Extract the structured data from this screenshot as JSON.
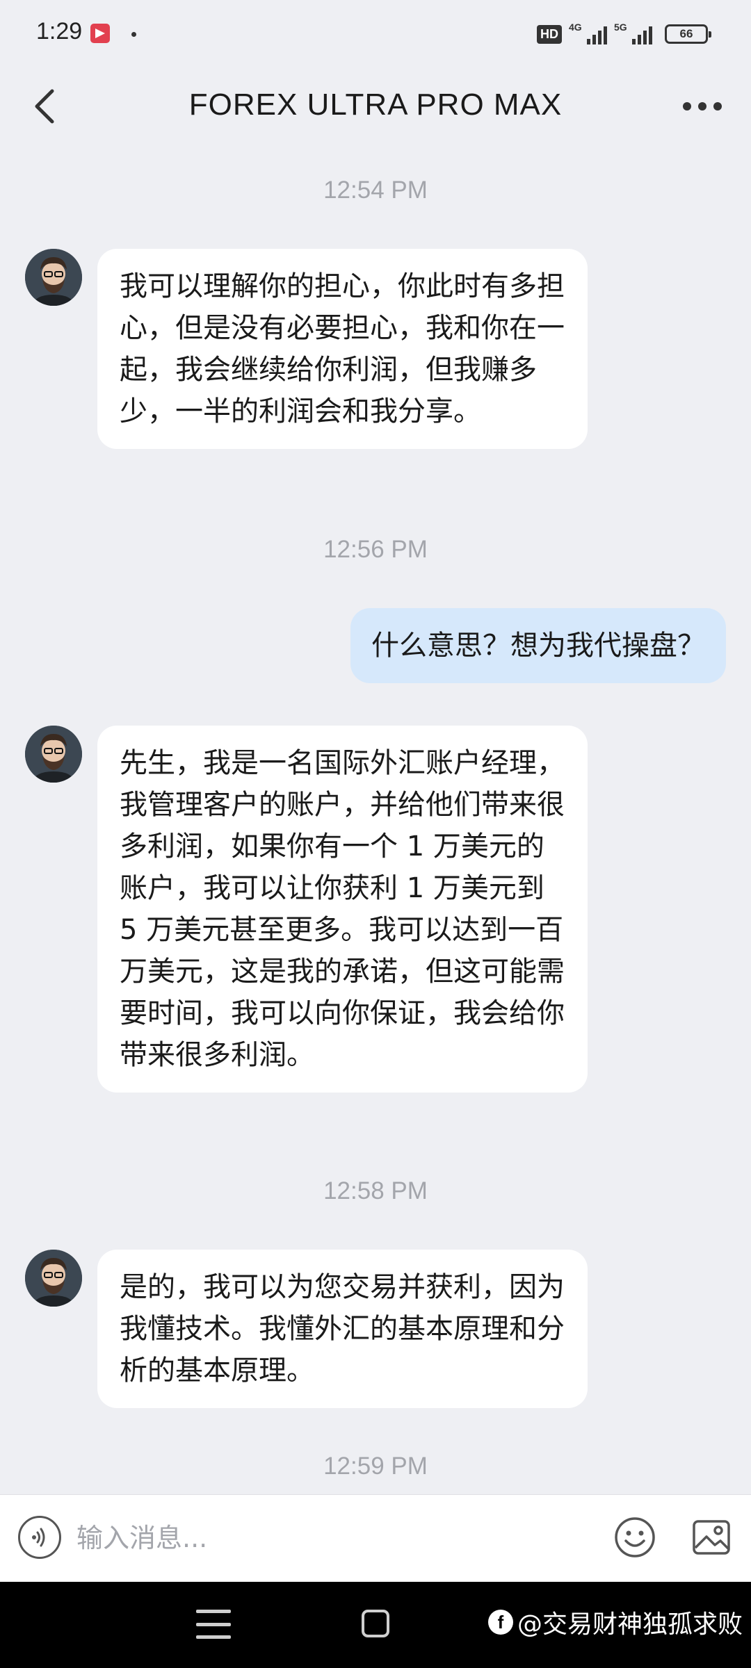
{
  "status_bar": {
    "time": "1:29",
    "hd_badge": "HD",
    "network_1": "4G",
    "network_2": "5G",
    "battery": "66"
  },
  "header": {
    "title": "FOREX ULTRA PRO MAX",
    "back_icon": "chevron-left-icon",
    "more_icon": "more-horizontal-icon"
  },
  "messages": [
    {
      "type": "time",
      "text": "12:54 PM"
    },
    {
      "type": "incoming",
      "text": "我可以理解你的担心，你此时有多担心，但是没有必要担心，我和你在一起，我会继续给你利润，但我赚多少，一半的利润会和我分享。"
    },
    {
      "type": "time",
      "text": "12:56 PM"
    },
    {
      "type": "outgoing",
      "text": "什么意思？想为我代操盘？"
    },
    {
      "type": "incoming",
      "text": "先生，我是一名国际外汇账户经理，我管理客户的账户，并给他们带来很多利润，如果你有一个 1 万美元的账户，我可以让你获利 1 万美元到 5 万美元甚至更多。我可以达到一百万美元，这是我的承诺，但这可能需要时间，我可以向你保证，我会给你带来很多利润。"
    },
    {
      "type": "time",
      "text": "12:58 PM"
    },
    {
      "type": "incoming",
      "text": "是的，我可以为您交易并获利，因为我懂技术。我懂外汇的基本原理和分析的基本原理。"
    },
    {
      "type": "time",
      "text": "12:59 PM"
    }
  ],
  "input_bar": {
    "placeholder": "输入消息...",
    "voice_icon": "voice-icon",
    "emoji_icon": "emoji-icon",
    "image_icon": "image-icon"
  },
  "watermark": {
    "logo": "f",
    "text": "@交易财神独孤求败"
  },
  "colors": {
    "background": "#eeeff3",
    "incoming_bubble": "#ffffff",
    "outgoing_bubble": "#d6e8fb",
    "timestamp": "#a3a5ab"
  }
}
